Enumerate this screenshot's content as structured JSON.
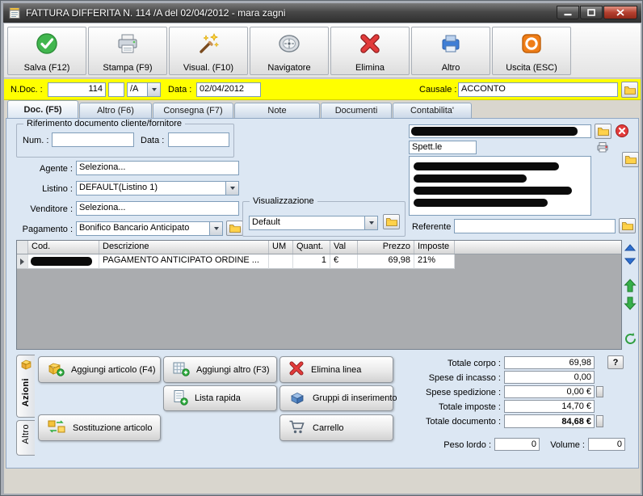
{
  "window": {
    "title": "FATTURA DIFFERITA N. 114 /A del 02/04/2012 - mara zagni"
  },
  "toolbar": {
    "buttons": [
      {
        "label": "Salva (F12)",
        "icon": "save-check-icon"
      },
      {
        "label": "Stampa (F9)",
        "icon": "printer-icon"
      },
      {
        "label": "Visual. (F10)",
        "icon": "magic-wand-icon"
      },
      {
        "label": "Navigatore",
        "icon": "compass-icon"
      },
      {
        "label": "Elimina",
        "icon": "delete-x-icon"
      },
      {
        "label": "Altro",
        "icon": "blue-printer-icon"
      },
      {
        "label": "Uscita (ESC)",
        "icon": "exit-power-icon"
      }
    ]
  },
  "docbar": {
    "ndoc_label": "N.Doc. :",
    "ndoc_value": "114",
    "rev_value": "",
    "suffix_value": "/A",
    "data_label": "Data :",
    "data_value": "02/04/2012",
    "causale_label": "Causale :",
    "causale_value": "ACCONTO"
  },
  "tabs": [
    {
      "label": "Doc. (F5)"
    },
    {
      "label": "Altro (F6)"
    },
    {
      "label": "Consegna (F7)"
    },
    {
      "label": "Note"
    },
    {
      "label": "Documenti"
    },
    {
      "label": "Contabilita'"
    }
  ],
  "form": {
    "riferimento_legend": "Riferimento documento cliente/fornitore",
    "num_label": "Num. :",
    "num_value": "",
    "rif_data_label": "Data :",
    "rif_data_value": "",
    "agente_label": "Agente :",
    "agente_value": "Seleziona...",
    "listino_label": "Listino :",
    "listino_value": "DEFAULT(Listino 1)",
    "venditore_label": "Venditore :",
    "venditore_value": "Seleziona...",
    "pagamento_label": "Pagamento :",
    "pagamento_value": "Bonifico Bancario Anticipato",
    "visualizzazione_legend": "Visualizzazione",
    "visualizzazione_value": "Default",
    "spett_value": "Spett.le",
    "referente_label": "Referente",
    "referente_value": ""
  },
  "table": {
    "headers": [
      "Cod.",
      "Descrizione",
      "UM",
      "Quant.",
      "Val",
      "Prezzo",
      "Imposte"
    ],
    "rows": [
      {
        "cod": "",
        "descrizione": "PAGAMENTO ANTICIPATO ORDINE ...",
        "um": "",
        "quant": "1",
        "val": "€",
        "prezzo": "69,98",
        "imposte": "21%"
      }
    ]
  },
  "actions": {
    "side_tabs": [
      {
        "label": "Azioni"
      },
      {
        "label": "Altro"
      }
    ],
    "buttons": [
      {
        "label": "Aggiungi articolo (F4)",
        "icon": "add-article-icon"
      },
      {
        "label": "Aggiungi altro (F3)",
        "icon": "add-other-icon"
      },
      {
        "label": "Elimina linea",
        "icon": "delete-line-icon"
      },
      {
        "label": "Lista rapida",
        "icon": "quick-list-icon"
      },
      {
        "label": "Gruppi di inserimento",
        "icon": "insert-groups-icon"
      },
      {
        "label": "Sostituzione articolo",
        "icon": "replace-article-icon"
      },
      {
        "label": "Carrello",
        "icon": "cart-icon"
      }
    ]
  },
  "totals": {
    "totale_corpo_label": "Totale corpo :",
    "totale_corpo_value": "69,98",
    "help_label": "?",
    "spese_incasso_label": "Spese di incasso :",
    "spese_incasso_value": "0,00",
    "spese_spedizione_label": "Spese spedizione :",
    "spese_spedizione_value": "0,00",
    "spese_spedizione_currency": "€",
    "totale_imposte_label": "Totale imposte :",
    "totale_imposte_value": "14,70",
    "totale_imposte_currency": "€",
    "totale_documento_label": "Totale documento :",
    "totale_documento_value": "84,68",
    "totale_documento_currency": "€",
    "peso_lordo_label": "Peso lordo :",
    "peso_lordo_value": "0",
    "volume_label": "Volume :",
    "volume_value": "0"
  },
  "colors": {
    "highlight_bar": "#ffff00",
    "panel": "#dce7f3",
    "save_green": "#41b64e",
    "delete_red": "#e23b3b",
    "exit_orange": "#ef7d17"
  }
}
